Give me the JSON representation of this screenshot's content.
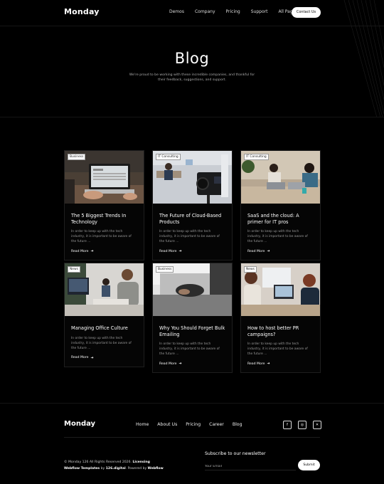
{
  "nav": {
    "logo": "Monday",
    "links": [
      "Demos",
      "Company",
      "Pricing",
      "Support",
      "All Pages"
    ],
    "contact_label": "Contact Us"
  },
  "hero": {
    "title": "Blog",
    "subtitle": "We're proud to be working with these incredible companies, and thankful for their feedback, suggestions, and support."
  },
  "posts": [
    {
      "tag": "Business",
      "title": "The 5 Biggest Trends In Technology",
      "excerpt": "In order to keep up with the tech industry, it is important to be aware of the future ...",
      "read_more": "Read More",
      "image": "laptop-desk-photo"
    },
    {
      "tag": "IT Consulting",
      "title": "The Future of Cloud-Based Products",
      "excerpt": "In order to keep up with the tech industry, it is important to be aware of the future ...",
      "read_more": "Read More",
      "image": "film-camera-studio-photo"
    },
    {
      "tag": "IT Consulting",
      "title": "SaaS and the cloud: A primer for IT pros",
      "excerpt": "In order to keep up with the tech industry, it is important to be aware of the future ...",
      "read_more": "Read More",
      "image": "two-people-laptops-photo"
    },
    {
      "tag": "News",
      "title": "Managing Office Culture",
      "excerpt": "In order to keep up with the tech industry, it is important to be aware of the future ...",
      "read_more": "Read More",
      "image": "office-workers-photo"
    },
    {
      "tag": "Business",
      "title": "Why You Should Forget Bulk Emailing",
      "excerpt": "In order to keep up with the tech industry, it is important to be aware of the future ...",
      "read_more": "Read More",
      "image": "hands-typing-laptop-photo"
    },
    {
      "tag": "News",
      "title": "How to host better PR campaigns?",
      "excerpt": "In order to keep up with the tech industry, it is important to be aware of the future ...",
      "read_more": "Read More",
      "image": "meeting-laptop-photo"
    }
  ],
  "footer": {
    "logo": "Monday",
    "links": [
      "Home",
      "About Us",
      "Pricing",
      "Career",
      "Blog"
    ],
    "socials": [
      "facebook-icon",
      "instagram-icon",
      "x-icon"
    ],
    "copyright_prefix": "© Monday 126 All Rights Reserved 2026. ",
    "licensing": "Licensing",
    "webflow_templates": "Webflow Templates",
    "by": " by ",
    "digital": "126.digital",
    "powered": ". Powered by ",
    "webflow": "Webflow",
    "subscribe_title": "Subscribe to our newsletter",
    "email_placeholder": "Your Email",
    "submit_label": "Submit"
  },
  "colors": {
    "background": "#000000",
    "text": "#ffffff",
    "muted": "#999999"
  }
}
